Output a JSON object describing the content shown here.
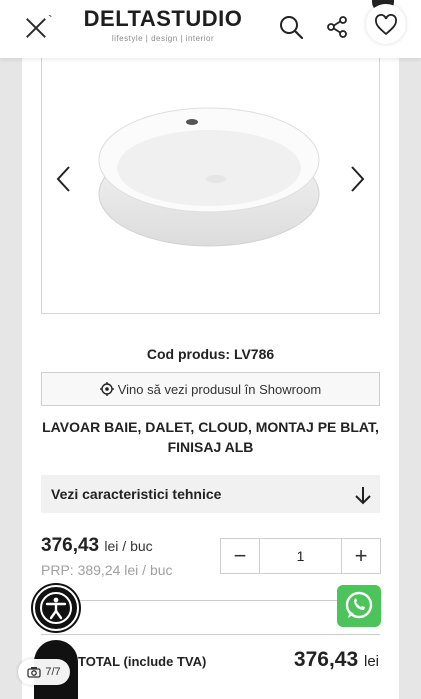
{
  "header": {
    "logo_main": "DELTASTUDIO",
    "logo_sub": "lifestyle | design | interior",
    "tick": "`"
  },
  "product": {
    "code_label": "Cod produs: LV786",
    "showroom_text": "Vino să vezi produsul în Showroom",
    "title": "LAVOAR BAIE, DALET, CLOUD, MONTAJ PE BLAT, FINISAJ ALB",
    "specs_label": "Vezi caracteristici tehnice"
  },
  "pricing": {
    "price": "376,43",
    "price_unit": "lei / buc",
    "prp": "PRP: 389,24 lei / buc",
    "quantity": "1",
    "minus": "−",
    "plus": "+",
    "total_label": "TOTAL (include TVA)",
    "total_value": "376,43",
    "total_currency": "lei"
  },
  "gallery": {
    "counter": "7/7"
  },
  "icons": {
    "close": "close-icon",
    "search": "search-icon",
    "share": "share-icon",
    "favorite": "heart-icon",
    "gallery_prev": "chevron-left-icon",
    "gallery_next": "chevron-right-icon",
    "showroom": "location-pin-icon",
    "specs": "arrow-down-icon",
    "accessibility": "accessibility-icon",
    "whatsapp": "whatsapp-icon",
    "camera": "camera-icon"
  },
  "colors": {
    "whatsapp": "#4cc35b",
    "accent_dark": "#111111",
    "muted_text": "#a0a0a0"
  }
}
